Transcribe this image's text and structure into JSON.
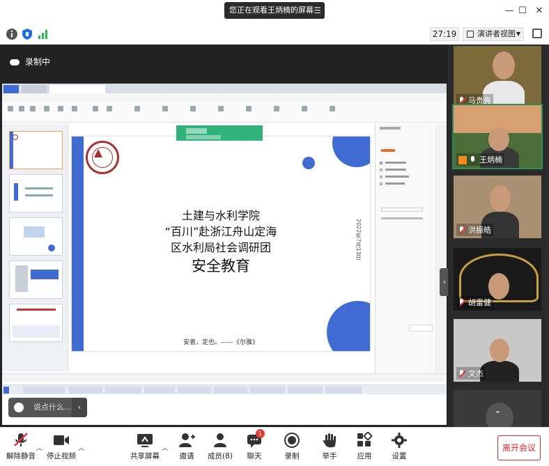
{
  "banner": {
    "text": "您正在观看王炳楠的屏幕",
    "menu_icon": "menu-icon"
  },
  "window": {
    "minimize": "—",
    "maximize": "☐",
    "close": "✕"
  },
  "toolbar": {
    "timer": "27:19",
    "view_mode": "演讲者视图",
    "icons": [
      "info-icon",
      "shield-icon",
      "signal-icon",
      "fullscreen-icon"
    ]
  },
  "recording": {
    "label": "录制中"
  },
  "slide": {
    "title_line1": "土建与水利学院",
    "title_line2": "“百川”赴浙江舟山定海",
    "title_line3": "区水利局社会调研团",
    "title_line4": "安全教育",
    "date": "2022年7月13日",
    "quote": "安者，定也。——《尔雅》"
  },
  "chat_input": {
    "placeholder": "说点什么..."
  },
  "participants": [
    {
      "name": "马贵亮",
      "muted": true
    },
    {
      "name": "王炳楠",
      "muted": false,
      "active": true
    },
    {
      "name": "洪振皓",
      "muted": true
    },
    {
      "name": "胡雷健",
      "muted": true
    },
    {
      "name": "文杰",
      "muted": true
    },
    {
      "name": "",
      "muted": true
    }
  ],
  "bottom_bar": {
    "unmute": "解除静音",
    "stop_video": "停止视频",
    "share_screen": "共享屏幕",
    "invite": "邀请",
    "members": "成员(8)",
    "chat": "聊天",
    "chat_badge": "1",
    "record": "录制",
    "raise_hand": "举手",
    "apps": "应用",
    "settings": "设置",
    "leave": "离开会议"
  },
  "colors": {
    "accent_blue": "#3f6bd3",
    "leave_red": "#e02828",
    "active_green": "#2e8b57",
    "badge_red": "#e53935"
  }
}
